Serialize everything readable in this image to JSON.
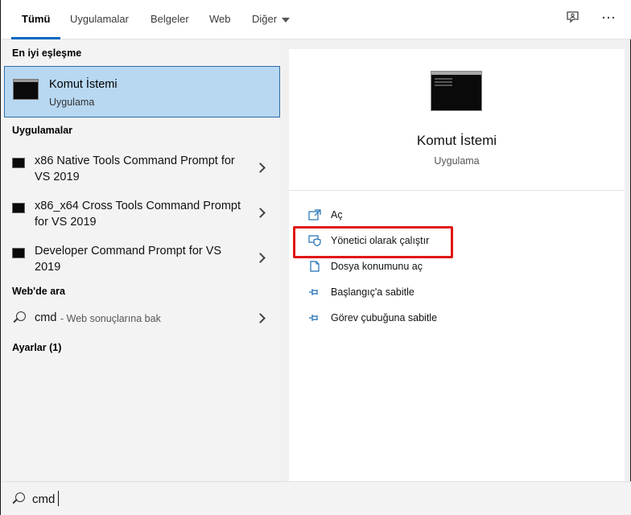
{
  "tabs": [
    {
      "label": "Tümü",
      "active": true
    },
    {
      "label": "Uygulamalar"
    },
    {
      "label": "Belgeler"
    },
    {
      "label": "Web"
    },
    {
      "label": "Diğer"
    }
  ],
  "left": {
    "best_match_header": "En iyi eşleşme",
    "best_match": {
      "title": "Komut İstemi",
      "subtitle": "Uygulama"
    },
    "apps_header": "Uygulamalar",
    "apps": [
      {
        "label": "x86 Native Tools Command Prompt for VS 2019"
      },
      {
        "label": "x86_x64 Cross Tools Command Prompt for VS 2019"
      },
      {
        "label": "Developer Command Prompt for VS 2019"
      }
    ],
    "web_header": "Web'de ara",
    "web": {
      "query": "cmd",
      "hint": "- Web sonuçlarına bak"
    },
    "settings_header": "Ayarlar (1)"
  },
  "right": {
    "title": "Komut İstemi",
    "subtitle": "Uygulama",
    "actions": [
      {
        "label": "Aç",
        "icon": "open-icon"
      },
      {
        "label": "Yönetici olarak çalıştır",
        "icon": "shield-icon"
      },
      {
        "label": "Dosya konumunu aç",
        "icon": "file-location-icon"
      },
      {
        "label": "Başlangıç'a sabitle",
        "icon": "pin-icon"
      },
      {
        "label": "Görev çubuğuna sabitle",
        "icon": "pin-icon"
      }
    ]
  },
  "search": {
    "value": "cmd"
  },
  "colors": {
    "accent": "#0067c0",
    "selection": "#b8d8f2",
    "highlight": "#e01616"
  }
}
